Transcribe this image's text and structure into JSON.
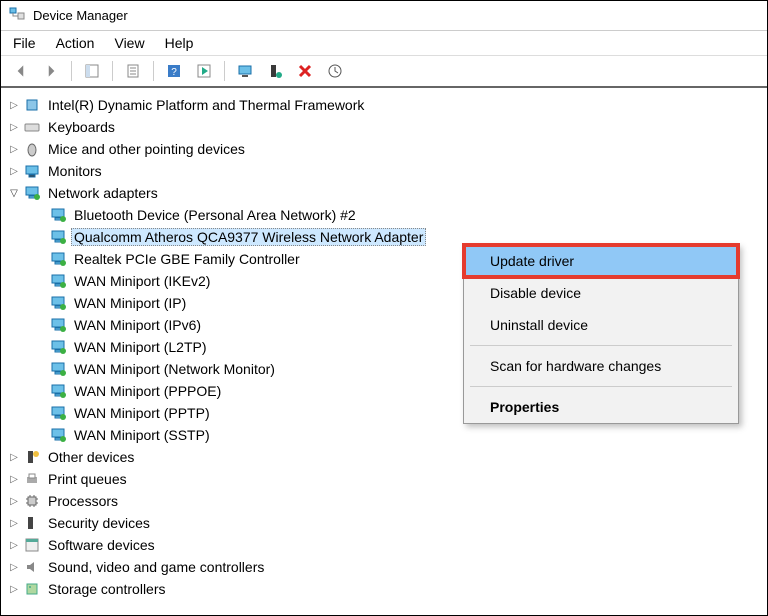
{
  "window": {
    "title": "Device Manager"
  },
  "menu": {
    "file": "File",
    "action": "Action",
    "view": "View",
    "help": "Help"
  },
  "tree": {
    "intel_dpt": "Intel(R) Dynamic Platform and Thermal Framework",
    "keyboards": "Keyboards",
    "mice": "Mice and other pointing devices",
    "monitors": "Monitors",
    "network": "Network adapters",
    "net_children": [
      "Bluetooth Device (Personal Area Network) #2",
      "Qualcomm Atheros QCA9377 Wireless Network Adapter",
      "Realtek PCIe GBE Family Controller",
      "WAN Miniport (IKEv2)",
      "WAN Miniport (IP)",
      "WAN Miniport (IPv6)",
      "WAN Miniport (L2TP)",
      "WAN Miniport (Network Monitor)",
      "WAN Miniport (PPPOE)",
      "WAN Miniport (PPTP)",
      "WAN Miniport (SSTP)"
    ],
    "other": "Other devices",
    "print": "Print queues",
    "proc": "Processors",
    "sec": "Security devices",
    "soft": "Software devices",
    "sound": "Sound, video and game controllers",
    "storage": "Storage controllers"
  },
  "ctx": {
    "update": "Update driver",
    "disable": "Disable device",
    "uninstall": "Uninstall device",
    "scan": "Scan for hardware changes",
    "props": "Properties"
  }
}
